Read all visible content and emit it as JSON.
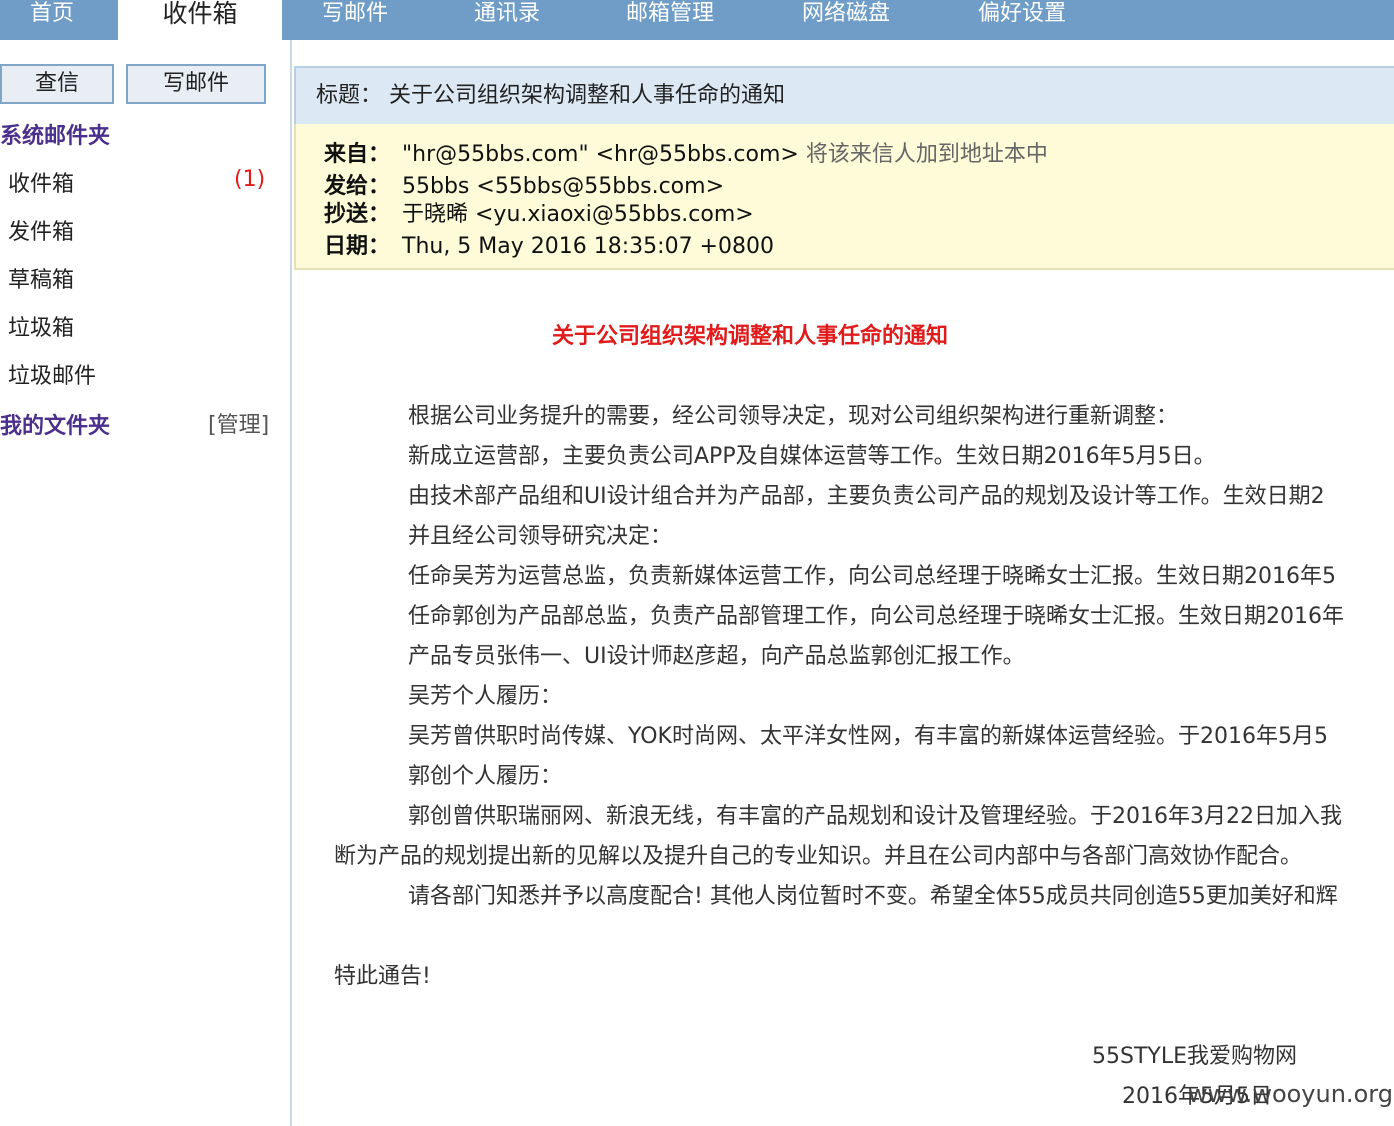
{
  "nav": {
    "tabs": [
      {
        "label": "首页"
      },
      {
        "label": "收件箱"
      },
      {
        "label": "写邮件"
      },
      {
        "label": "通讯录"
      },
      {
        "label": "邮箱管理"
      },
      {
        "label": "网络磁盘"
      },
      {
        "label": "偏好设置"
      }
    ],
    "active_tab": "收件箱"
  },
  "sidebar": {
    "check_mail_label": "查信",
    "compose_label": "写邮件",
    "system_folders_title": "系统邮件夹",
    "folders": [
      {
        "label": "收件箱",
        "unread": "(1)"
      },
      {
        "label": "发件箱"
      },
      {
        "label": "草稿箱"
      },
      {
        "label": "垃圾箱"
      },
      {
        "label": "垃圾邮件"
      }
    ],
    "my_folders_title": "我的文件夹",
    "manage_label": "[管理]"
  },
  "email": {
    "subject_label": "标题：",
    "subject": "关于公司组织架构调整和人事任命的通知",
    "from_label": "来自：",
    "from": "\"hr@55bbs.com\" <hr@55bbs.com>",
    "add_to_addressbook": "将该来信人加到地址本中",
    "to_label": "发给：",
    "to": "55bbs <55bbs@55bbs.com>",
    "cc_label": "抄送：",
    "cc": "于晓晞 <yu.xiaoxi@55bbs.com>",
    "date_label": "日期：",
    "date": "Thu, 5 May 2016 18:35:07 +0800",
    "body_title": "关于公司组织架构调整和人事任命的通知",
    "paragraphs": [
      "根据公司业务提升的需要，经公司领导决定，现对公司组织架构进行重新调整：",
      "新成立运营部，主要负责公司APP及自媒体运营等工作。生效日期2016年5月5日。",
      "由技术部产品组和UI设计组合并为产品部，主要负责公司产品的规划及设计等工作。生效日期2",
      "并且经公司领导研究决定：",
      "任命吴芳为运营总监，负责新媒体运营工作，向公司总经理于晓晞女士汇报。生效日期2016年5",
      "任命郭创为产品部总监，负责产品部管理工作，向公司总经理于晓晞女士汇报。生效日期2016年",
      "产品专员张伟一、UI设计师赵彦超，向产品总监郭创汇报工作。",
      "吴芳个人履历：",
      "吴芳曾供职时尚传媒、YOK时尚网、太平洋女性网，有丰富的新媒体运营经验。于2016年5月5",
      "郭创个人履历：",
      "郭创曾供职瑞丽网、新浪无线，有丰富的产品规划和设计及管理经验。于2016年3月22日加入我",
      "断为产品的规划提出新的见解以及提升自己的专业知识。并且在公司内部中与各部门高效协作配合。",
      "请各部门知悉并予以高度配合! 其他人岗位暂时不变。希望全体55成员共同创造55更加美好和辉"
    ],
    "closing": "特此通告!",
    "signature_org": "55STYLE我爱购物网",
    "signature_date": "2016年5月5日"
  },
  "watermark": "www.wooyun.org"
}
